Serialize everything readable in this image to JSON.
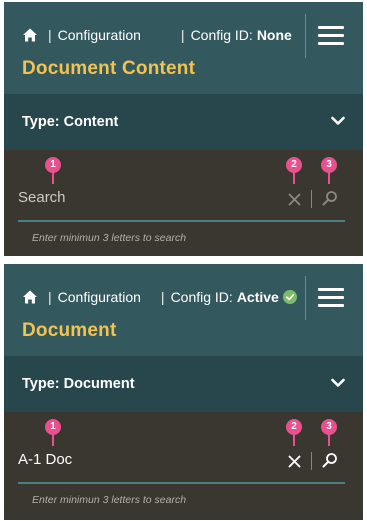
{
  "panels": [
    {
      "breadcrumb": {
        "home_icon": "home-icon",
        "separator": "|",
        "section": "Configuration"
      },
      "config": {
        "separator": "|",
        "label": "Config ID:",
        "value": "None",
        "status_icon": ""
      },
      "menu_icon": "hamburger-menu-icon",
      "title": "Document Content",
      "type_selector": {
        "label": "Type: Content",
        "icon": "chevron-down-icon"
      },
      "search": {
        "value": "",
        "placeholder": "Search",
        "clear_icon": "close-icon",
        "submit_icon": "search-icon",
        "hint": "Enter minimun 3 letters to search"
      },
      "callouts": [
        "1",
        "2",
        "3"
      ]
    },
    {
      "breadcrumb": {
        "home_icon": "home-icon",
        "separator": "|",
        "section": "Configuration"
      },
      "config": {
        "separator": "|",
        "label": "Config ID:",
        "value": "Active",
        "status_icon": "check-circle-icon"
      },
      "menu_icon": "hamburger-menu-icon",
      "title": "Document",
      "type_selector": {
        "label": "Type: Document",
        "icon": "chevron-down-icon"
      },
      "search": {
        "value": "A-1 Doc",
        "placeholder": "",
        "clear_icon": "close-icon",
        "submit_icon": "search-icon",
        "hint": "Enter minimun 3 letters to search"
      },
      "callouts": [
        "1",
        "2",
        "3"
      ]
    }
  ],
  "colors": {
    "header_bg": "#33595f",
    "type_bar_bg": "#27474d",
    "search_bg": "#3a3630",
    "title": "#f3c24f",
    "callout": "#e8508f",
    "active_check": "#7dbb6a"
  }
}
